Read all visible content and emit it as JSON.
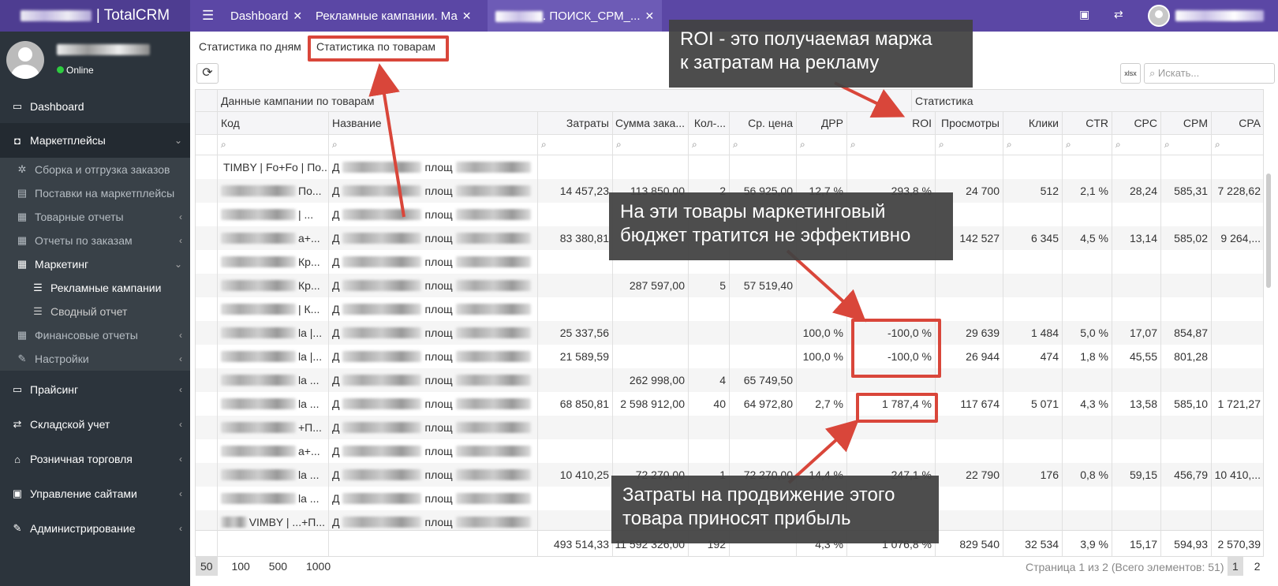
{
  "app": {
    "name": "| TotalCRM"
  },
  "tabs": [
    {
      "label": "Dashboard",
      "close": "✕"
    },
    {
      "label": "Рекламные кампании. Ма",
      "close": "✕"
    },
    {
      "label": ". ПОИСК_СРМ_...",
      "close": "✕"
    }
  ],
  "user": {
    "status": "Online"
  },
  "sidebar": {
    "items": [
      {
        "label": "Dashboard",
        "icon": "monitor-icon"
      },
      {
        "label": "Маркетплейсы",
        "icon": "bag-icon"
      },
      {
        "label": "Сборка и отгрузка заказов",
        "icon": "gears-icon"
      },
      {
        "label": "Поставки на маркетплейсы",
        "icon": "box-icon"
      },
      {
        "label": "Товарные отчеты",
        "icon": "table-icon"
      },
      {
        "label": "Отчеты по заказам",
        "icon": "table-icon"
      },
      {
        "label": "Маркетинг",
        "icon": "table-icon"
      },
      {
        "label": "Рекламные кампании",
        "icon": "list-icon"
      },
      {
        "label": "Сводный отчет",
        "icon": "list-icon"
      },
      {
        "label": "Финансовые отчеты",
        "icon": "table-icon"
      },
      {
        "label": "Настройки",
        "icon": "wrench-icon"
      },
      {
        "label": "Прайсинг",
        "icon": "card-icon"
      },
      {
        "label": "Складской учет",
        "icon": "exchange-icon"
      },
      {
        "label": "Розничная торговля",
        "icon": "bank-icon"
      },
      {
        "label": "Управление сайтами",
        "icon": "window-icon"
      },
      {
        "label": "Администрирование",
        "icon": "wrench-icon"
      }
    ]
  },
  "subtabs": {
    "by_days": "Статистика по дням",
    "by_products": "Статистика по товарам"
  },
  "search": {
    "placeholder": "Искать..."
  },
  "toolbar": {
    "xls": "xlsx"
  },
  "table": {
    "group_campaign": "Данные кампании по товарам",
    "group_stats": "Статистика",
    "columns": [
      "Код",
      "Название",
      "Затраты",
      "Сумма зака...",
      "Кол-...",
      "Ср. цена",
      "ДРР",
      "ROI",
      "Просмотры",
      "Клики",
      "CTR",
      "CPC",
      "CPM",
      "CPA"
    ],
    "rows": [
      {
        "code": "TIMBY | Fo+Fo | По...",
        "name": "Д",
        "name2": "площ",
        "v": [
          "",
          "",
          "",
          "",
          "",
          "",
          "",
          "",
          "",
          "",
          "",
          "",
          ""
        ]
      },
      {
        "code": "По...",
        "name": "Д",
        "name2": "площ",
        "v": [
          "14 457,23",
          "113 850,00",
          "2",
          "56 925,00",
          "12,7 %",
          "293,8 %",
          "24 700",
          "512",
          "2,1 %",
          "28,24",
          "585,31",
          "7 228,62"
        ]
      },
      {
        "code": "| ...",
        "name": "Д",
        "name2": "площ",
        "v": [
          "",
          "",
          "",
          "",
          "",
          "",
          "",
          "",
          "",
          "",
          "",
          ""
        ]
      },
      {
        "code": "а+...",
        "name": "Д",
        "name2": "площ",
        "v": [
          "83 380,81",
          "",
          "",
          "",
          "",
          "",
          "142 527",
          "6 345",
          "4,5 %",
          "13,14",
          "585,02",
          "9 264,..."
        ]
      },
      {
        "code": "Кр...",
        "name": "Д",
        "name2": "площ",
        "v": [
          "",
          "",
          "",
          "",
          "",
          "",
          "",
          "",
          "",
          "",
          "",
          ""
        ]
      },
      {
        "code": "Кр...",
        "name": "Д",
        "name2": "площ",
        "v": [
          "",
          "287 597,00",
          "5",
          "57 519,40",
          "",
          "",
          "",
          "",
          "",
          "",
          "",
          ""
        ]
      },
      {
        "code": "| К...",
        "name": "Д",
        "name2": "площ",
        "v": [
          "",
          "",
          "",
          "",
          "",
          "",
          "",
          "",
          "",
          "",
          "",
          ""
        ]
      },
      {
        "code": "la |...",
        "name": "Д",
        "name2": "площ",
        "v": [
          "25 337,56",
          "",
          "",
          "",
          "100,0 %",
          "-100,0 %",
          "29 639",
          "1 484",
          "5,0 %",
          "17,07",
          "854,87",
          ""
        ]
      },
      {
        "code": "la |...",
        "name": "Д",
        "name2": "площ",
        "v": [
          "21 589,59",
          "",
          "",
          "",
          "100,0 %",
          "-100,0 %",
          "26 944",
          "474",
          "1,8 %",
          "45,55",
          "801,28",
          ""
        ]
      },
      {
        "code": "la ...",
        "name": "Д",
        "name2": "площ",
        "v": [
          "",
          "262 998,00",
          "4",
          "65 749,50",
          "",
          "",
          "",
          "",
          "",
          "",
          "",
          ""
        ]
      },
      {
        "code": "la ...",
        "name": "Д",
        "name2": "площ",
        "v": [
          "68 850,81",
          "2 598 912,00",
          "40",
          "64 972,80",
          "2,7 %",
          "1 787,4 %",
          "117 674",
          "5 071",
          "4,3 %",
          "13,58",
          "585,10",
          "1 721,27"
        ]
      },
      {
        "code": "+П...",
        "name": "Д",
        "name2": "площ",
        "v": [
          "",
          "",
          "",
          "",
          "",
          "",
          "",
          "",
          "",
          "",
          "",
          ""
        ]
      },
      {
        "code": "а+...",
        "name": "Д",
        "name2": "площ",
        "v": [
          "",
          "",
          "",
          "",
          "",
          "",
          "",
          "",
          "",
          "",
          "",
          ""
        ]
      },
      {
        "code": "la ...",
        "name": "Д",
        "name2": "площ",
        "v": [
          "10 410,25",
          "72 270,00",
          "1",
          "72 270,00",
          "14,4 %",
          "247,1 %",
          "22 790",
          "176",
          "0,8 %",
          "59,15",
          "456,79",
          "10 410,..."
        ]
      },
      {
        "code": "la ...",
        "name": "Д",
        "name2": "площ",
        "v": [
          "",
          "",
          "",
          "",
          "",
          "",
          "",
          "",
          "",
          "",
          "",
          ""
        ]
      },
      {
        "code": "VIMBY | ...+П...",
        "name": "Д",
        "name2": "площ",
        "v": [
          "",
          "",
          "",
          "",
          "",
          "",
          "",
          "",
          "",
          "",
          "",
          ""
        ]
      }
    ],
    "totals": [
      "493 514,33",
      "11 592 326,00",
      "192",
      "",
      "4,3 %",
      "1 076,8 %",
      "829 540",
      "32 534",
      "3,9 %",
      "15,17",
      "594,93",
      "2 570,39"
    ]
  },
  "pager": {
    "sizes": [
      "50",
      "100",
      "500",
      "1000"
    ],
    "info": "Страница 1 из 2 (Всего элементов: 51)",
    "pages": [
      "1",
      "2"
    ]
  },
  "annotations": {
    "roi": "ROI - это получаемая маржа\nк затратам на рекламу",
    "bad": "На эти товары маркетинговый\nбюджет тратится не эффективно",
    "good": "Затраты на продвижение этого\nтовара приносят прибыль"
  },
  "colors": {
    "topbar": "#5b47a5",
    "sidebar": "#2c343c",
    "annotation": "#d9463a"
  }
}
